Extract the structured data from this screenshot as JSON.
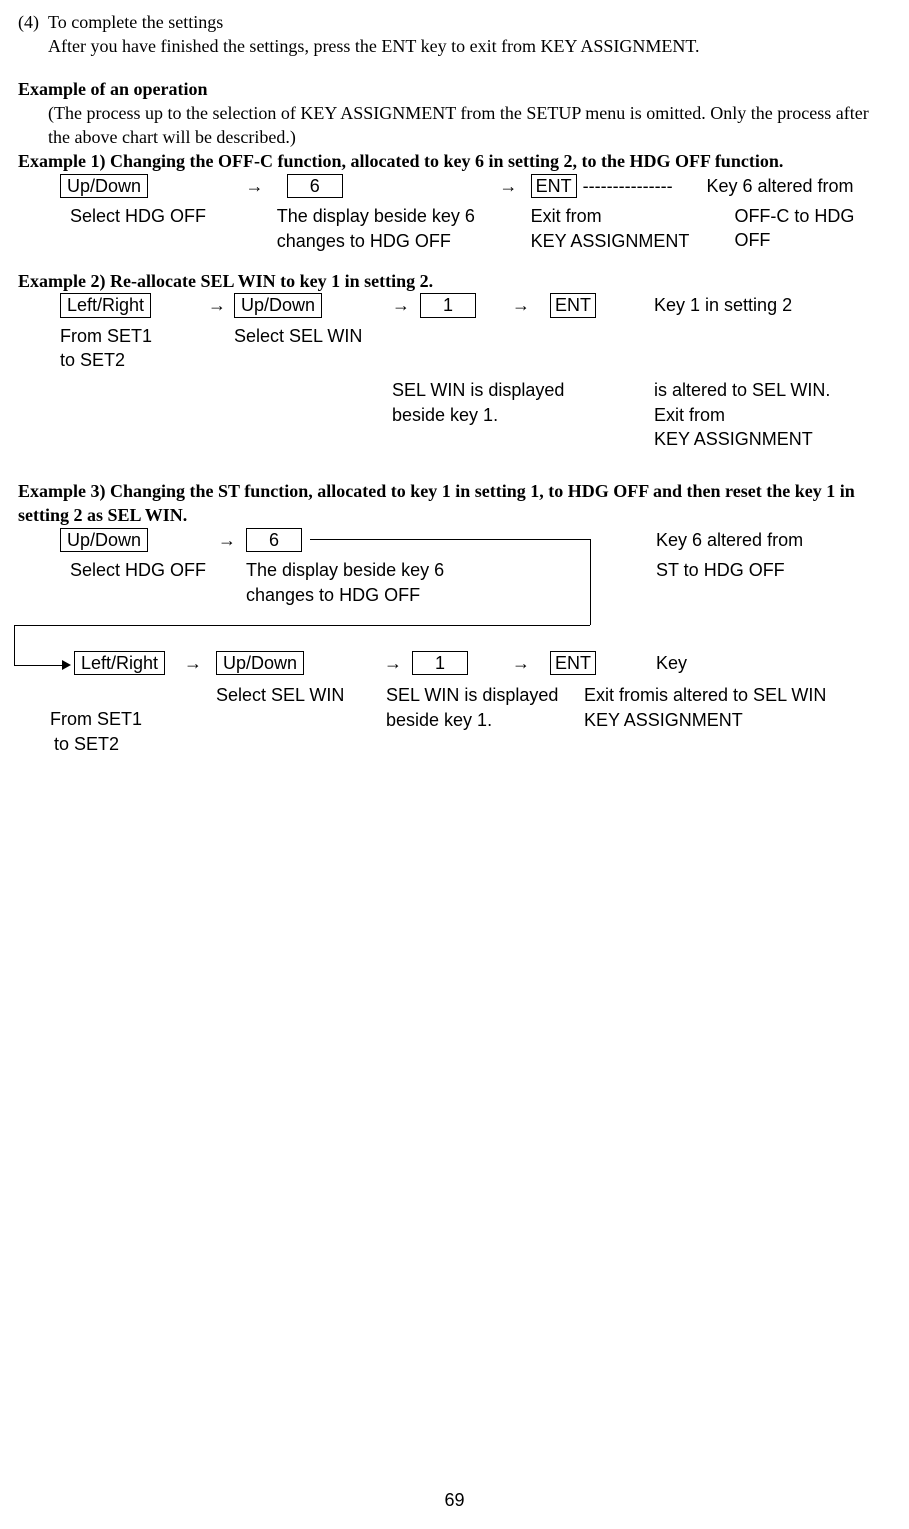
{
  "section4": {
    "num": "(4)",
    "title": "To complete the settings",
    "body": "After you have finished the settings, press the ENT key to exit from KEY ASSIGNMENT."
  },
  "exop_heading": "Example of an operation",
  "exop_body": "(The process up to the selection of KEY ASSIGNMENT from the SETUP menu is omitted.  Only the process after the above chart will be described.)",
  "ex1": {
    "heading": "Example 1)  Changing the OFF-C function, allocated to key 6 in setting 2, to the HDG OFF function.",
    "step1_box": "Up/Down",
    "step1_desc": "Select HDG OFF",
    "step2_box": "6",
    "step2_desc_l1": "The display beside key 6",
    "step2_desc_l2": "changes to HDG OFF",
    "step3_box": "ENT",
    "step3_dashes": "---------------",
    "step3_desc_l1": "Exit from",
    "step3_desc_l2": "KEY ASSIGNMENT",
    "result_l1": "Key 6 altered from",
    "result_l2": "OFF-C to HDG OFF"
  },
  "ex2": {
    "heading": "Example 2)  Re-allocate SEL WIN to key 1 in setting 2.",
    "step1_box": "Left/Right",
    "step1_desc_l1": "From SET1",
    "step1_desc_l2": "to SET2",
    "step2_box": "Up/Down",
    "step2_desc": "Select SEL WIN",
    "step3_box": "1",
    "step3_desc_l1": "SEL WIN is displayed",
    "step3_desc_l2": "beside key 1.",
    "step4_box": "ENT",
    "result_l1": "Key 1 in setting 2",
    "result_l2": "is altered to SEL WIN.",
    "result_l3": "Exit from",
    "result_l4": "KEY ASSIGNMENT"
  },
  "ex3": {
    "heading": "Example 3) Changing the ST function, allocated to key 1 in setting 1, to HDG OFF and then reset the key 1 in setting 2 as SEL WIN.",
    "r1_step1_box": "Up/Down",
    "r1_step1_desc": "Select HDG OFF",
    "r1_step2_box": "6",
    "r1_step2_desc_l1": "The display beside key 6",
    "r1_step2_desc_l2": "changes to HDG OFF",
    "r1_result_l1": "Key 6 altered from",
    "r1_result_l2": "ST to HDG OFF",
    "r2_step1_box": "Left/Right",
    "r2_step1_desc_l1": "From SET1",
    "r2_step1_desc_l2": "to SET2",
    "r2_step2_box": "Up/Down",
    "r2_step2_desc": "Select SEL WIN",
    "r2_step3_box": "1",
    "r2_step3_desc_l1": "SEL WIN is displayed",
    "r2_step3_desc_l2": "beside key 1.",
    "r2_step4_box": "ENT",
    "r2_result_l1": "Key",
    "r2_result_l2": "Exit fromis altered to SEL WIN",
    "r2_result_l3": "KEY ASSIGNMENT"
  },
  "arrow": "→",
  "pagenum": "69"
}
